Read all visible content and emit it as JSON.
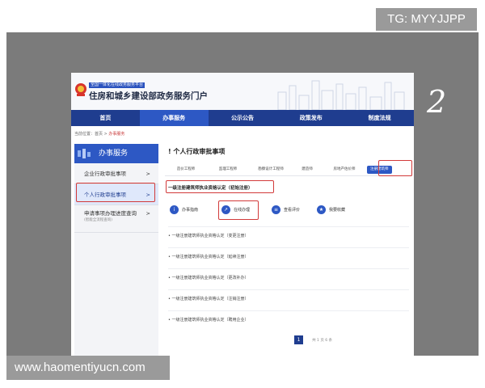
{
  "overlay": {
    "tg_badge": "TG: MYYJJPP",
    "url_badge": "www.haomentiyucn.com",
    "annotation": "2"
  },
  "header": {
    "tag": "全国一体化在线政务服务平台",
    "title": "住房和城乡建设部政务服务门户"
  },
  "nav": {
    "items": [
      {
        "label": "首页"
      },
      {
        "label": "办事服务"
      },
      {
        "label": "公示公告"
      },
      {
        "label": "政策发布"
      },
      {
        "label": "制度法规"
      }
    ]
  },
  "breadcrumb": {
    "prefix": "当前位置：首页 >",
    "current": "办事服务"
  },
  "sidebar": {
    "title": "办事服务",
    "items": [
      {
        "label": "企业行政审批事项",
        "chevron": ">"
      },
      {
        "label": "个人行政审批事项",
        "chevron": ">"
      },
      {
        "label": "申请事项办理进度查询",
        "sub": "(智能全流程查询)",
        "chevron": ">"
      }
    ]
  },
  "content": {
    "title": "! 个人行政审批事项",
    "tabs": [
      {
        "label": "造价工程师"
      },
      {
        "label": "监理工程师"
      },
      {
        "label": "勘察设计工程师"
      },
      {
        "label": "建造师"
      },
      {
        "label": "房地产估价师"
      },
      {
        "label": "注册建筑师"
      }
    ],
    "selected_item": "一级注册建筑师执业资格认定（初始注册）",
    "actions": [
      {
        "label": "办事指南",
        "icon": "i"
      },
      {
        "label": "在线办理",
        "icon": "↗"
      },
      {
        "label": "查看评价",
        "icon": "≡"
      },
      {
        "label": "我要收藏",
        "icon": "★"
      }
    ],
    "list": [
      {
        "label": "• 一级注册建筑师执业资格认定（变更注册）"
      },
      {
        "label": "• 一级注册建筑师执业资格认定（延续注册）"
      },
      {
        "label": "• 一级注册建筑师执业资格认定（更改补办）"
      },
      {
        "label": "• 一级注册建筑师执业资格认定（注销注册）"
      },
      {
        "label": "• 一级注册建筑师执业资格认定（聘用企业）"
      }
    ],
    "pager": {
      "page": "1",
      "total": "共 1 页 6 条"
    }
  },
  "colors": {
    "nav_bg": "#1f3d8f",
    "accent": "#2d58c4",
    "highlight_outline": "#d23a3a"
  }
}
